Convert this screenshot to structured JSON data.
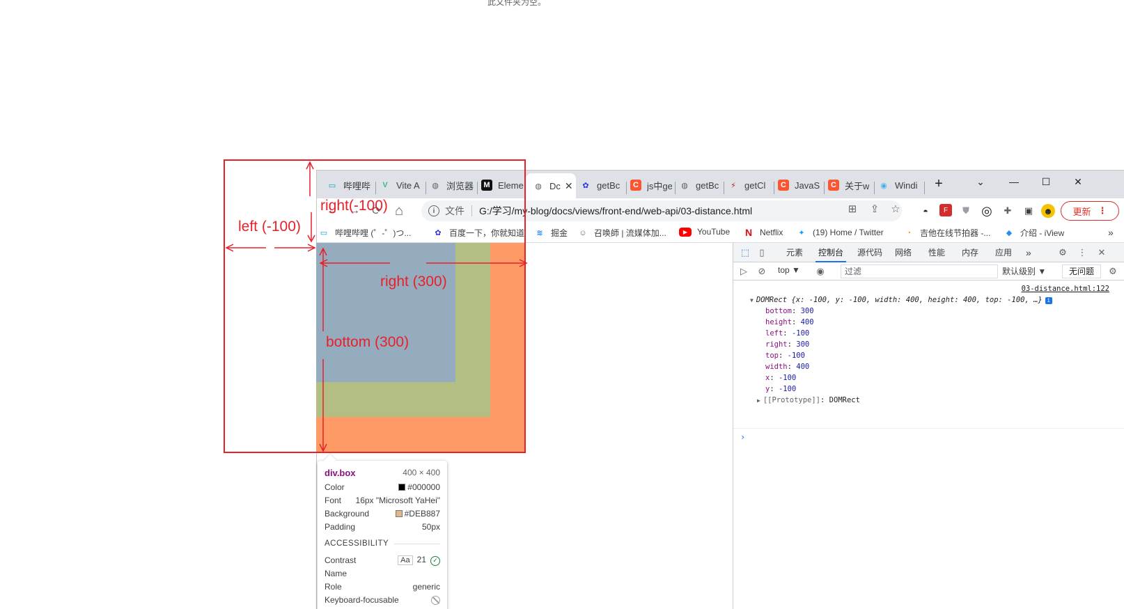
{
  "page_note": "此文件夹为空。",
  "browser": {
    "tabs": [
      {
        "label": "哔哩哔",
        "icon": "bilibili-icon",
        "glyph": "▭",
        "color": "#00a1d6"
      },
      {
        "label": "Vite A",
        "icon": "vue-icon",
        "glyph": "V",
        "color": "#42b883"
      },
      {
        "label": "浏览器",
        "icon": "globe-icon",
        "glyph": "◍",
        "color": "#5f6368"
      },
      {
        "label": "Eleme",
        "icon": "medium-icon",
        "glyph": "M",
        "color": "#ffffff"
      },
      {
        "label": "Dc",
        "icon": "globe-icon",
        "glyph": "◍",
        "color": "#5f6368"
      },
      {
        "label": "getBc",
        "icon": "baidu-icon",
        "glyph": "✿",
        "color": "#2932e1"
      },
      {
        "label": "js中ge",
        "icon": "csdn-icon",
        "glyph": "C",
        "color": "#ffffff"
      },
      {
        "label": "getBc",
        "icon": "globe-icon",
        "glyph": "◍",
        "color": "#5f6368"
      },
      {
        "label": "getCl",
        "icon": "flash-icon",
        "glyph": "⚡",
        "color": "#c4161c"
      },
      {
        "label": "JavaS",
        "icon": "csdn-icon",
        "glyph": "C",
        "color": "#ffffff"
      },
      {
        "label": "关于w",
        "icon": "csdn-icon",
        "glyph": "C",
        "color": "#ffffff"
      },
      {
        "label": "Windi",
        "icon": "windicss-icon",
        "glyph": "◉",
        "color": "#48b0f1"
      }
    ],
    "new_tab": "+",
    "tab_search": "⌄",
    "minimize": "—",
    "maximize": "☐",
    "close": "✕",
    "back": "←",
    "forward": "→",
    "reload": "⟳",
    "home": "⌂",
    "scheme_label": "文件",
    "url": "G:/学习/my-blog/docs/views/front-end/web-api/03-distance.html",
    "update_label": "更新",
    "bookmarks": [
      {
        "label": "哔哩哔哩 (゜-゜)つ...",
        "icon": "bilibili-icon",
        "glyph": "▭",
        "color": "#00a1d6"
      },
      {
        "label": "百度一下，你就知道",
        "icon": "baidu-icon",
        "glyph": "✿",
        "color": "#2932e1"
      },
      {
        "label": "掘金",
        "icon": "juejin-icon",
        "glyph": "≋",
        "color": "#1e80ff"
      },
      {
        "label": "召唤師 | 流媒体加...",
        "icon": "ghost-icon",
        "glyph": "☺",
        "color": "#5f6368"
      },
      {
        "label": "YouTube",
        "icon": "youtube-icon",
        "glyph": "▶",
        "color": "#ff0000"
      },
      {
        "label": "Netflix",
        "icon": "netflix-icon",
        "glyph": "N",
        "color": "#e50914"
      },
      {
        "label": "(19) Home / Twitter",
        "icon": "twitter-icon",
        "glyph": "✦",
        "color": "#1d9bf0"
      },
      {
        "label": "吉他在线节拍器 -...",
        "icon": "metronome-icon",
        "glyph": "◔",
        "color": "#f4a100"
      },
      {
        "label": "介绍 - iView",
        "icon": "iview-icon",
        "glyph": "◆",
        "color": "#2d8cf0"
      }
    ],
    "bookmarks_more": "»"
  },
  "annotations": {
    "right_top": "right(-100)",
    "left": "left (-100)",
    "right": "right (300)",
    "bottom": "bottom (300)"
  },
  "tooltip": {
    "selector": "div.box",
    "size": "400 × 400",
    "color_label": "Color",
    "color_value": "#000000",
    "color_swatch": "#000000",
    "font_label": "Font",
    "font_value": "16px \"Microsoft YaHei\"",
    "background_label": "Background",
    "background_value": "#DEB887",
    "background_swatch": "#deb887",
    "padding_label": "Padding",
    "padding_value": "50px",
    "accessibility_heading": "ACCESSIBILITY",
    "contrast_label": "Contrast",
    "contrast_aa": "Aa",
    "contrast_value": "21",
    "name_label": "Name",
    "role_label": "Role",
    "role_value": "generic",
    "keyboard_label": "Keyboard-focusable"
  },
  "devtools": {
    "tabs": [
      "元素",
      "控制台",
      "源代码",
      "网络",
      "性能",
      "内存",
      "应用"
    ],
    "active_tab": "控制台",
    "more_tabs": "»",
    "context": "top ▼",
    "filter_placeholder": "过滤",
    "levels": "默认级别 ▼",
    "issues": "无问题",
    "console": {
      "source": "03-distance.html:122",
      "summary_type": "DOMRect",
      "summary": "{x: -100, y: -100, width: 400, height: 400, top: -100, …}",
      "props": [
        {
          "key": "bottom",
          "value": "300"
        },
        {
          "key": "height",
          "value": "400"
        },
        {
          "key": "left",
          "value": "-100"
        },
        {
          "key": "right",
          "value": "300"
        },
        {
          "key": "top",
          "value": "-100"
        },
        {
          "key": "width",
          "value": "400"
        },
        {
          "key": "x",
          "value": "-100"
        },
        {
          "key": "y",
          "value": "-100"
        }
      ],
      "prototype_key": "[[Prototype]]",
      "prototype_value": "DOMRect",
      "prompt": "›"
    }
  }
}
